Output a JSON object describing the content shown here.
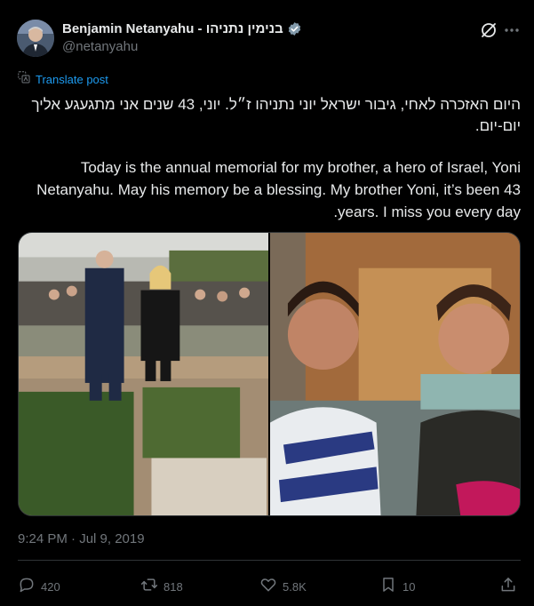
{
  "author": {
    "display_name": "Benjamin Netanyahu - בנימין נתניהו",
    "handle": "@netanyahu",
    "verified": true
  },
  "translate_label": "Translate post",
  "text": {
    "hebrew": "היום האזכרה לאחי, גיבור ישראל יוני נתניהו ז״ל. יוני, 43 שנים אני מתגעגע אליך יום-יום.",
    "english": "Today is the annual memorial for my brother, a hero of Israel, Yoni Netanyahu. May his memory be a blessing. My brother Yoni, it’s been 43 .years. I miss you every day"
  },
  "timestamp": "9:24 PM · Jul 9, 2019",
  "actions": {
    "replies": "420",
    "reposts": "818",
    "likes": "5.8K",
    "bookmarks": "10"
  },
  "icons": {
    "avatar": "avatar",
    "verified": "verified-badge-icon",
    "grok": "grok-icon",
    "more": "more-icon",
    "translate": "translate-icon",
    "reply": "reply-icon",
    "repost": "repost-icon",
    "like": "heart-icon",
    "bookmark": "bookmark-icon",
    "share": "share-icon"
  },
  "colors": {
    "background": "#000000",
    "text": "#e7e9ea",
    "muted": "#71767b",
    "link": "#1d9bf0",
    "border": "#2f3336"
  }
}
